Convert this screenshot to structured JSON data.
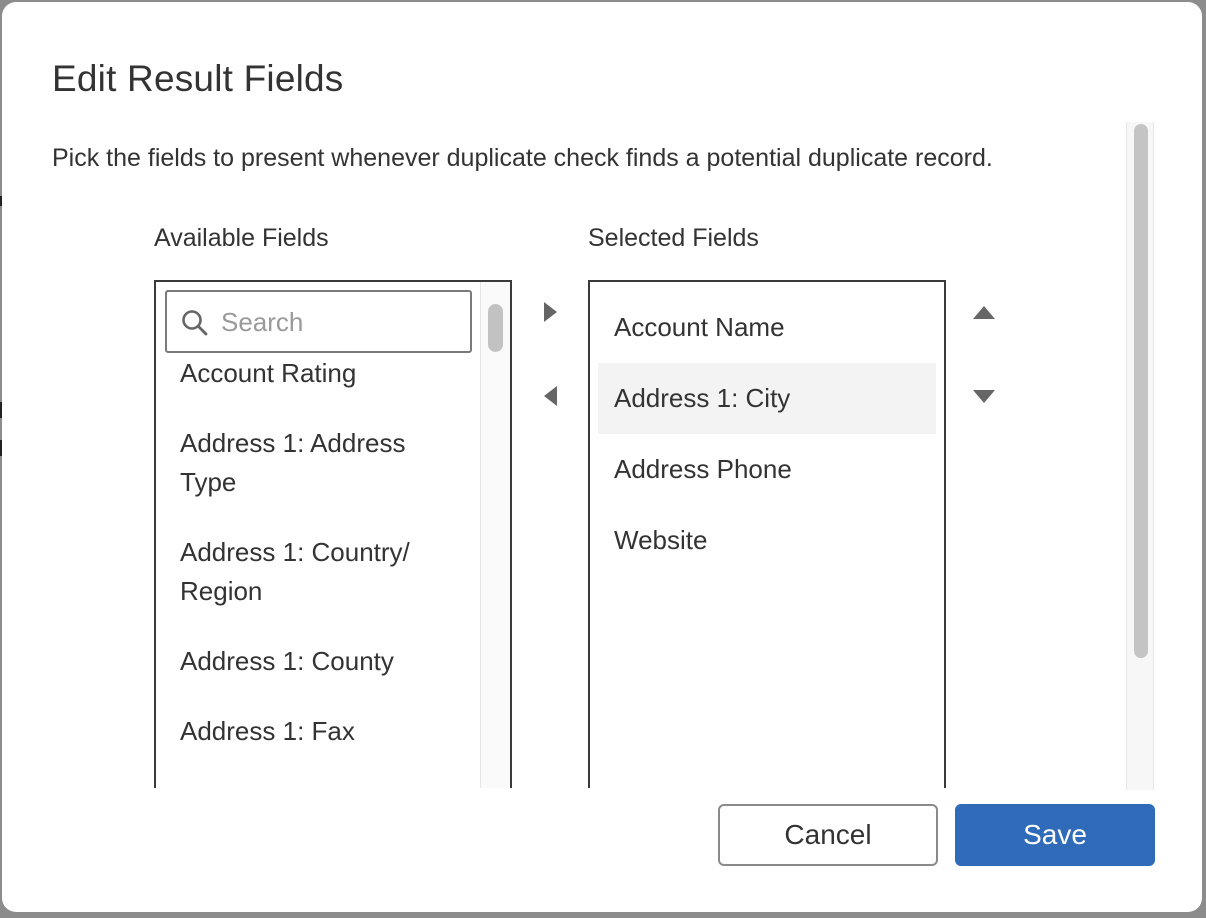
{
  "dialog": {
    "title": "Edit Result Fields",
    "description": "Pick the fields to present whenever duplicate check finds a potential duplicate record."
  },
  "available": {
    "label": "Available Fields",
    "search_placeholder": "Search",
    "items": [
      "Account Rating",
      "Address 1: Address Type",
      "Address 1: Country/ Region",
      "Address 1: County",
      "Address 1: Fax"
    ]
  },
  "selected": {
    "label": "Selected Fields",
    "items": [
      "Account Name",
      "Address 1: City",
      "Address Phone",
      "Website"
    ],
    "highlighted_item": "Address 1: City"
  },
  "footer": {
    "cancel_label": "Cancel",
    "save_label": "Save"
  },
  "icons": {
    "search": "search-icon",
    "move_right": "triangle-right-icon",
    "move_left": "triangle-left-icon",
    "move_up": "triangle-up-icon",
    "move_down": "triangle-down-icon"
  },
  "colors": {
    "primary": "#2f6bb8",
    "highlight": "#f3f3f3",
    "text": "#333333"
  }
}
